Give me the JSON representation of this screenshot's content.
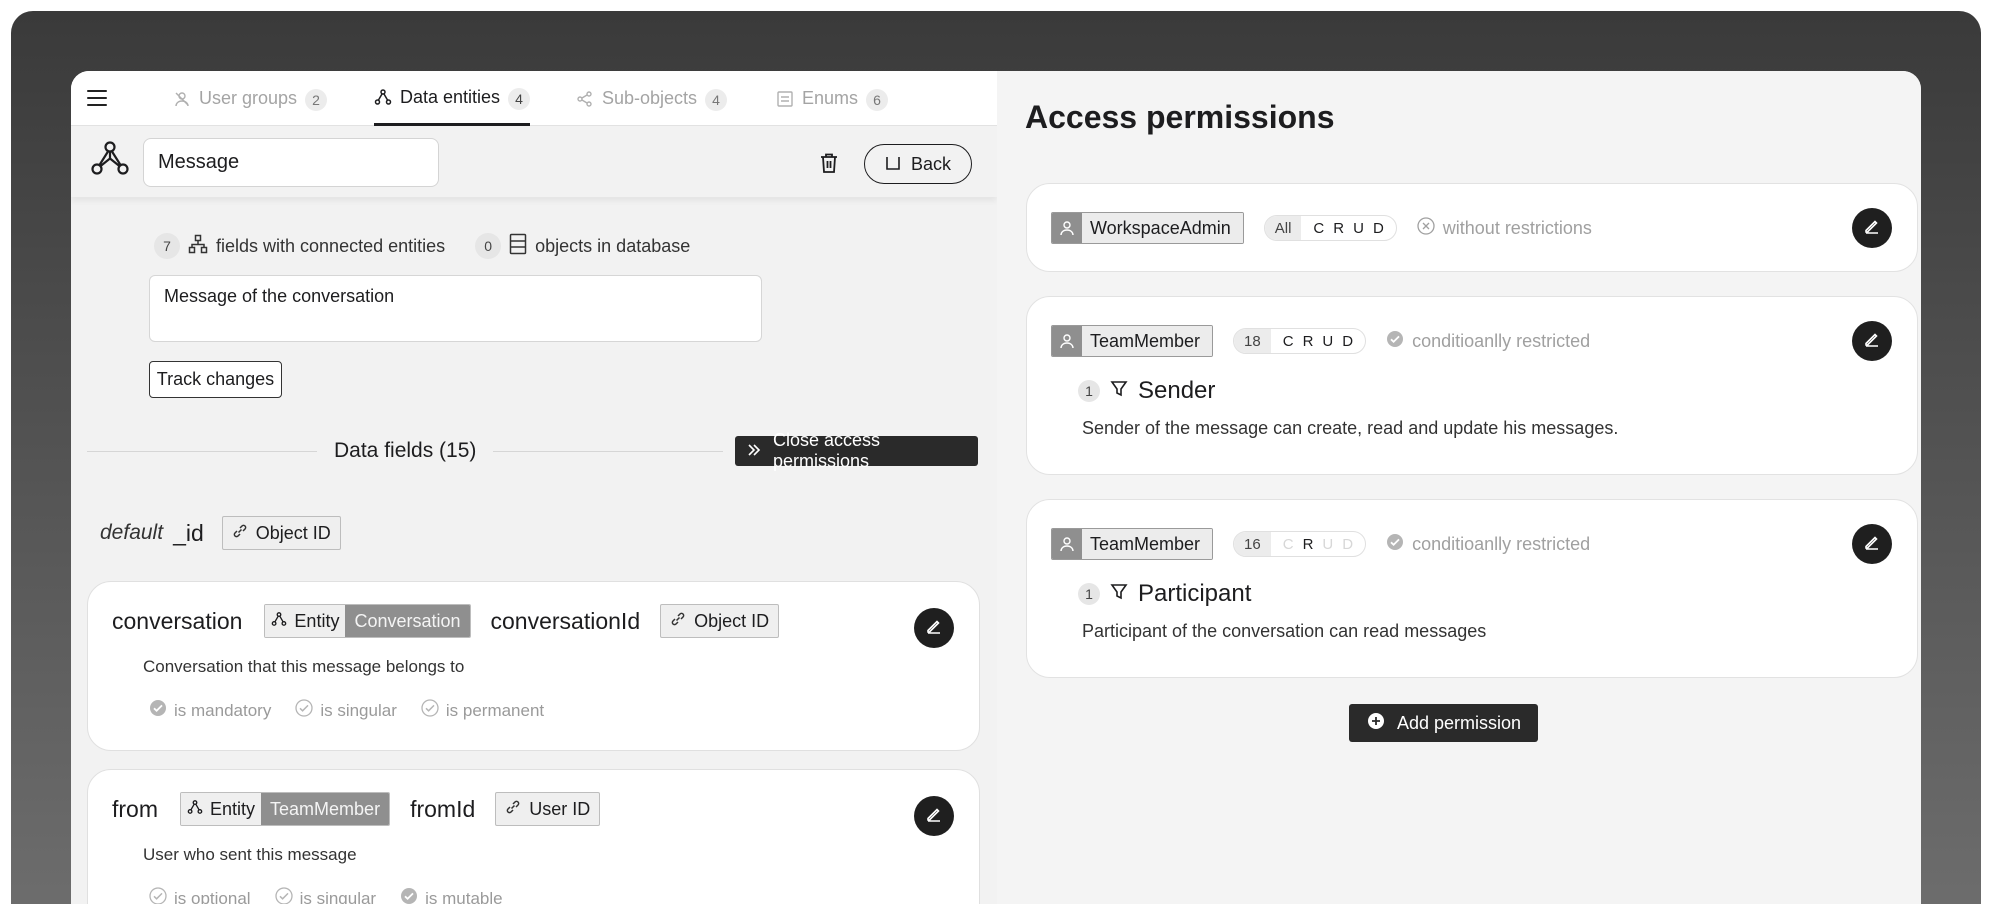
{
  "tabs": [
    {
      "label": "User groups",
      "count": "2"
    },
    {
      "label": "Data entities",
      "count": "4"
    },
    {
      "label": "Sub-objects",
      "count": "4"
    },
    {
      "label": "Enums",
      "count": "6"
    }
  ],
  "entity": {
    "name": "Message",
    "back_label": "Back",
    "stats": {
      "fields_count": "7",
      "fields_label": "fields with connected entities",
      "objects_count": "0",
      "objects_label": "objects in database"
    },
    "description": "Message of the conversation",
    "track_label": "Track changes"
  },
  "data_fields": {
    "title": "Data fields (15)",
    "close_perm_label": "Close access permissions",
    "default_label": "default",
    "default_id": "_id",
    "default_type": "Object ID",
    "fields": [
      {
        "name": "conversation",
        "entity_label": "Entity",
        "entity_target": "Conversation",
        "id_name": "conversationId",
        "id_type": "Object ID",
        "description": "Conversation that this message belongs to",
        "props": [
          "is mandatory",
          "is singular",
          "is permanent"
        ]
      },
      {
        "name": "from",
        "entity_label": "Entity",
        "entity_target": "TeamMember",
        "id_name": "fromId",
        "id_type": "User ID",
        "description": "User who sent this message",
        "props": [
          "is optional",
          "is singular",
          "is mutable"
        ]
      }
    ]
  },
  "permissions": {
    "title": "Access permissions",
    "items": [
      {
        "role": "WorkspaceAdmin",
        "count": "All",
        "crud": [
          "C",
          "R",
          "U",
          "D"
        ],
        "restriction": "without restrictions"
      },
      {
        "role": "TeamMember",
        "count": "18",
        "crud": [
          "C",
          "R",
          "U",
          "D"
        ],
        "restriction": "conditioanlly restricted",
        "condition_count": "1",
        "condition_name": "Sender",
        "condition_desc": "Sender of the message can create, read and update his messages."
      },
      {
        "role": "TeamMember",
        "count": "16",
        "crud": [
          "C",
          "R",
          "U",
          "D"
        ],
        "restriction": "conditioanlly restricted",
        "condition_count": "1",
        "condition_name": "Participant",
        "condition_desc": "Participant of the conversation can read messages"
      }
    ],
    "add_label": "Add permission"
  }
}
